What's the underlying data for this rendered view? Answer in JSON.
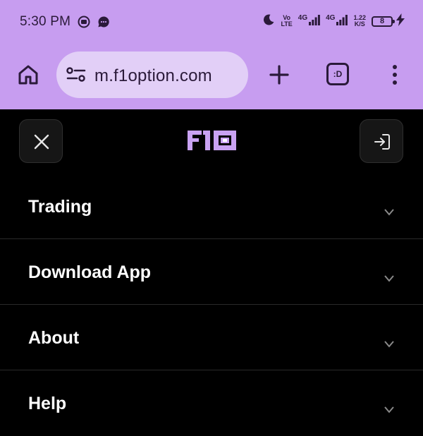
{
  "status_bar": {
    "time": "5:30 PM",
    "volte_top": "Vo",
    "volte_bottom": "LTE",
    "net1": "4G",
    "net2": "4G",
    "speed_value": "1.22",
    "speed_unit": "K/S",
    "battery_level": "8"
  },
  "browser": {
    "url": "m.f1option.com",
    "tab_icon_label": ":D"
  },
  "site": {
    "logo_text": "F1O"
  },
  "menu": {
    "items": [
      {
        "label": "Trading"
      },
      {
        "label": "Download App"
      },
      {
        "label": "About"
      },
      {
        "label": "Help"
      }
    ]
  },
  "colors": {
    "browser_chrome": "#C79DF0",
    "url_pill": "#E2CFF7",
    "page_background": "#000000",
    "brand_logo": "#C9A2F2",
    "menu_text": "#FFFFFF"
  }
}
